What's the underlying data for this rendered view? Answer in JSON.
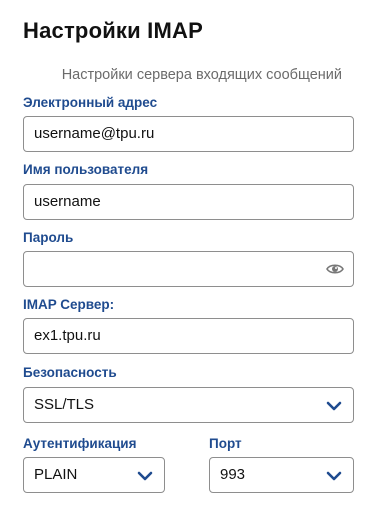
{
  "header": {
    "title": "Настройки IMAP",
    "subtitle": "Настройки сервера входящих сообщений"
  },
  "fields": {
    "email": {
      "label": "Электронный адрес",
      "value": "username@tpu.ru"
    },
    "username": {
      "label": "Имя пользователя",
      "value": "username"
    },
    "password": {
      "label": "Пароль",
      "value": "",
      "icon": "eye-icon"
    },
    "imap_server": {
      "label": "IMAP Сервер:",
      "value": "ex1.tpu.ru"
    },
    "security": {
      "label": "Безопасность",
      "value": "SSL/TLS",
      "icon": "chevron-down-icon"
    },
    "auth": {
      "label": "Аутентификация",
      "value": "PLAIN",
      "icon": "chevron-down-icon"
    },
    "port": {
      "label": "Порт",
      "value": "993",
      "icon": "chevron-down-icon"
    }
  },
  "colors": {
    "label": "#1f4b8f",
    "chevron": "#1f4b8f",
    "border": "#8e8e8e",
    "subtitle": "#6b6b6b"
  }
}
